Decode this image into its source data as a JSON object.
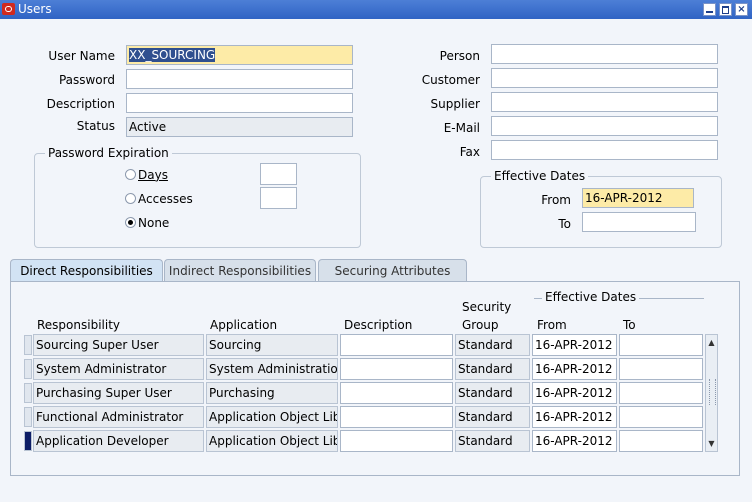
{
  "window": {
    "title": "Users"
  },
  "form": {
    "user_name": {
      "label": "User Name",
      "value": "XX_SOURCING"
    },
    "password": {
      "label": "Password",
      "value": ""
    },
    "description": {
      "label": "Description",
      "value": ""
    },
    "status": {
      "label": "Status",
      "value": "Active"
    },
    "person": {
      "label": "Person",
      "value": ""
    },
    "customer": {
      "label": "Customer",
      "value": ""
    },
    "supplier": {
      "label": "Supplier",
      "value": ""
    },
    "email": {
      "label": "E-Mail",
      "value": ""
    },
    "fax": {
      "label": "Fax",
      "value": ""
    }
  },
  "password_expiration": {
    "legend": "Password Expiration",
    "options": [
      "Days",
      "Accesses",
      "None"
    ],
    "selected": "None"
  },
  "effective_dates": {
    "legend": "Effective Dates",
    "from_label": "From",
    "from": "16-APR-2012",
    "to_label": "To",
    "to": ""
  },
  "tabs": [
    "Direct Responsibilities",
    "Indirect Responsibilities",
    "Securing Attributes"
  ],
  "table": {
    "headers": {
      "responsibility": "Responsibility",
      "application": "Application",
      "description": "Description",
      "security_group_1": "Security",
      "security_group_2": "Group",
      "effective_dates": "Effective Dates",
      "from": "From",
      "to": "To"
    },
    "rows": [
      {
        "responsibility": "Sourcing Super User",
        "application": "Sourcing",
        "description": "",
        "security_group": "Standard",
        "from": "16-APR-2012",
        "to": ""
      },
      {
        "responsibility": "System Administrator",
        "application": "System Administration",
        "description": "",
        "security_group": "Standard",
        "from": "16-APR-2012",
        "to": ""
      },
      {
        "responsibility": "Purchasing Super User",
        "application": "Purchasing",
        "description": "",
        "security_group": "Standard",
        "from": "16-APR-2012",
        "to": ""
      },
      {
        "responsibility": "Functional Administrator",
        "application": "Application Object Library",
        "description": "",
        "security_group": "Standard",
        "from": "16-APR-2012",
        "to": ""
      },
      {
        "responsibility": "Application Developer",
        "application": "Application Object Library",
        "description": "",
        "security_group": "Standard",
        "from": "16-APR-2012",
        "to": ""
      }
    ]
  }
}
